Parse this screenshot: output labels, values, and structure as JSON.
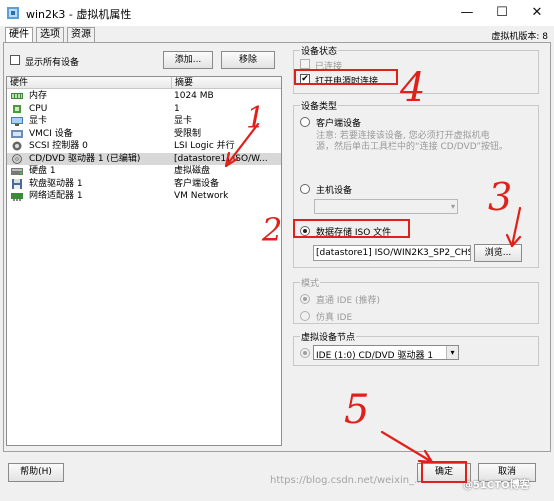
{
  "window": {
    "title": "win2k3 - 虚拟机属性",
    "minimize_glyph": "—",
    "maximize_glyph": "☐",
    "close_glyph": "✕"
  },
  "tabs": [
    {
      "label": "硬件"
    },
    {
      "label": "选项"
    },
    {
      "label": "资源"
    }
  ],
  "version": "虚拟机版本: 8",
  "left": {
    "show_all_devices_label": "显示所有设备",
    "add_button": "添加...",
    "remove_button": "移除",
    "table": {
      "col_hardware": "硬件",
      "col_summary": "摘要",
      "rows": [
        {
          "name": "内存",
          "summary": "1024 MB",
          "icon": "memory-icon",
          "selected": false
        },
        {
          "name": "CPU",
          "summary": "1",
          "icon": "cpu-icon",
          "selected": false
        },
        {
          "name": "显卡",
          "summary": "显卡",
          "icon": "display-card-icon",
          "selected": false
        },
        {
          "name": "VMCI 设备",
          "summary": "受限制",
          "icon": "vmci-icon",
          "selected": false
        },
        {
          "name": "SCSI 控制器 0",
          "summary": "LSI Logic 并行",
          "icon": "scsi-controller-icon",
          "selected": false
        },
        {
          "name": "CD/DVD 驱动器 1 (已编辑)",
          "summary": "[datastore1] ISO/W...",
          "icon": "cd-dvd-icon",
          "selected": true
        },
        {
          "name": "硬盘 1",
          "summary": "虚拟磁盘",
          "icon": "hard-disk-icon",
          "selected": false
        },
        {
          "name": "软盘驱动器 1",
          "summary": "客户端设备",
          "icon": "floppy-icon",
          "selected": false
        },
        {
          "name": "网络适配器 1",
          "summary": "VM Network",
          "icon": "network-adapter-icon",
          "selected": false
        }
      ]
    }
  },
  "device_status": {
    "title": "设备状态",
    "connected_label": "已连接",
    "connected_checked": false,
    "connect_at_power_on_label": "打开电源时连接",
    "connect_at_power_on_checked": true
  },
  "device_type": {
    "title": "设备类型",
    "client_device_label": "客户端设备",
    "client_device_note_line1": "注意: 若要连接该设备, 您必须打开虚拟机电",
    "client_device_note_line2": "源，然后单击工具栏中的“连接 CD/DVD”按钮。",
    "host_device_label": "主机设备",
    "datastore_iso_label": "数据存储 ISO 文件",
    "iso_path": "[datastore1] ISO/WIN2K3_SP2_CHS.",
    "browse_button": "浏览...",
    "selected": "datastore_iso"
  },
  "mode": {
    "title": "模式",
    "passthrough_ide_label": "直通 IDE (推荐)",
    "emulate_ide_label": "仿真 IDE"
  },
  "virtual_device_node": {
    "title": "虚拟设备节点",
    "selected_value": "IDE (1:0) CD/DVD 驱动器 1"
  },
  "footer": {
    "help_button": "帮助(H)",
    "ok_button": "确定",
    "cancel_button": "取消"
  },
  "annotations": {
    "num1": "1",
    "num2": "2",
    "num3": "3",
    "num4": "4",
    "num5": "5"
  },
  "watermark": "https://blog.csdn.net/weixin_...",
  "watermark_brand": "@51CTO博客",
  "colors": {
    "annotation_red": "#e0201a",
    "selected_row": "#d8d8d8",
    "window_bg": "#f0f0f0"
  }
}
